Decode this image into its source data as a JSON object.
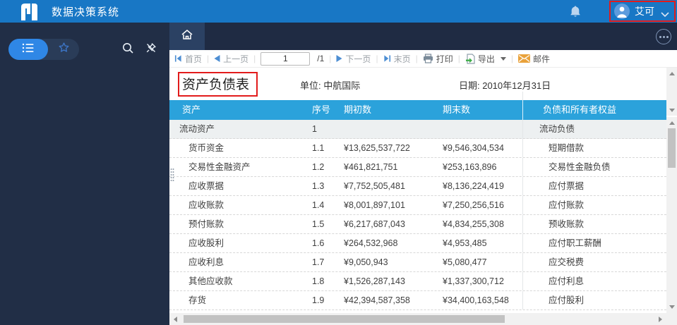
{
  "app": {
    "title": "数据决策系统",
    "user": "艾可"
  },
  "tabs": {
    "home": "home-tab"
  },
  "toolbar": {
    "first_label": "首页",
    "prev_label": "上一页",
    "page_value": "1",
    "page_total": "/1",
    "next_label": "下一页",
    "last_label": "末页",
    "print_label": "打印",
    "export_label": "导出",
    "mail_label": "邮件"
  },
  "report": {
    "title": "资产负债表",
    "unit": "单位: 中航国际",
    "date": "日期: 2010年12月31日",
    "columns": [
      "资产",
      "序号",
      "期初数",
      "期末数",
      "负债和所有者权益"
    ],
    "rows": [
      {
        "name": "流动资产",
        "no": "1",
        "begin": "",
        "end": "",
        "liability": "流动负债",
        "group": true
      },
      {
        "name": "货币资金",
        "no": "1.1",
        "begin": "¥13,625,537,722",
        "end": "¥9,546,304,534",
        "liability": "短期借款",
        "group": false
      },
      {
        "name": "交易性金融资产",
        "no": "1.2",
        "begin": "¥461,821,751",
        "end": "¥253,163,896",
        "liability": "交易性金融负债",
        "group": false
      },
      {
        "name": "应收票据",
        "no": "1.3",
        "begin": "¥7,752,505,481",
        "end": "¥8,136,224,419",
        "liability": "应付票据",
        "group": false
      },
      {
        "name": "应收账款",
        "no": "1.4",
        "begin": "¥8,001,897,101",
        "end": "¥7,250,256,516",
        "liability": "应付账款",
        "group": false
      },
      {
        "name": "预付账款",
        "no": "1.5",
        "begin": "¥6,217,687,043",
        "end": "¥4,834,255,308",
        "liability": "预收账款",
        "group": false
      },
      {
        "name": "应收股利",
        "no": "1.6",
        "begin": "¥264,532,968",
        "end": "¥4,953,485",
        "liability": "应付职工薪酬",
        "group": false
      },
      {
        "name": "应收利息",
        "no": "1.7",
        "begin": "¥9,050,943",
        "end": "¥5,080,477",
        "liability": "应交税费",
        "group": false
      },
      {
        "name": "其他应收款",
        "no": "1.8",
        "begin": "¥1,526,287,143",
        "end": "¥1,337,300,712",
        "liability": "应付利息",
        "group": false
      },
      {
        "name": "存货",
        "no": "1.9",
        "begin": "¥42,394,587,358",
        "end": "¥34,400,163,548",
        "liability": "应付股利",
        "group": false
      }
    ]
  },
  "icons": {
    "logo": "brand-f-logo",
    "bell": "notification-bell",
    "avatar": "user-person",
    "chevron": "chevron-down",
    "list": "directory-list",
    "star": "favorites-star",
    "search": "magnifier",
    "pin": "pin-off",
    "home": "house",
    "more": "ellipsis-circle",
    "print": "printer",
    "export": "page-with-green-arrow",
    "mail": "orange-envelope"
  },
  "colors": {
    "topbar_blue": "#1877C5",
    "sidebar_navy": "#212E46",
    "table_header_blue": "#2BA2DB",
    "accent_blue": "#2F87E6",
    "annotation_red": "#E21B1B",
    "export_green": "#3FAE49",
    "mail_orange": "#E9A23B"
  }
}
